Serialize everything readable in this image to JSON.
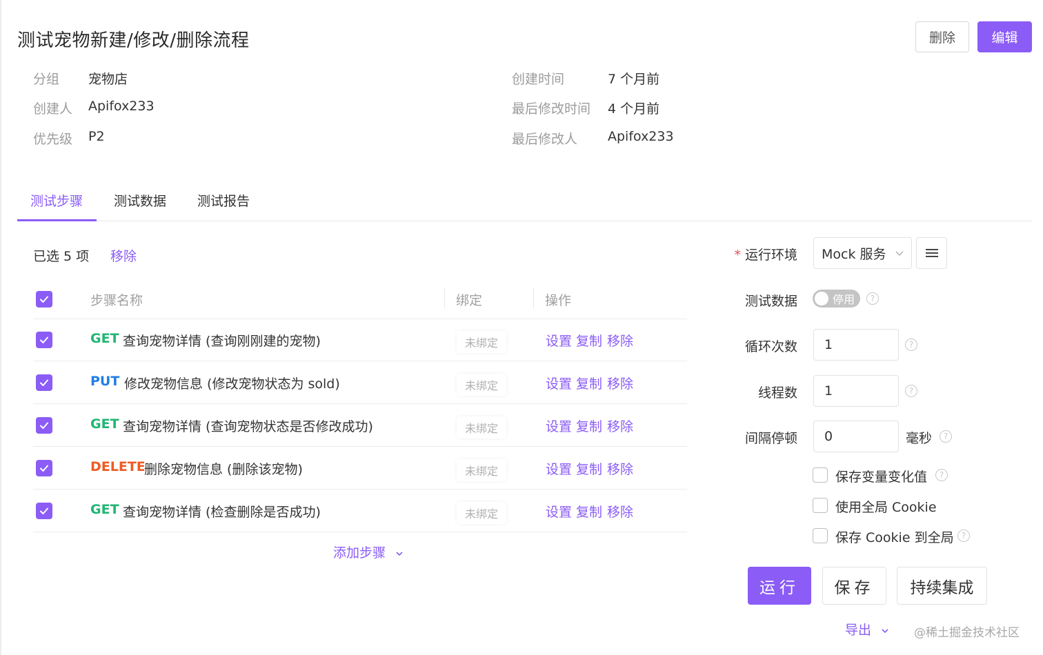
{
  "header": {
    "title": "测试宠物新建/修改/删除流程",
    "delete_label": "删除",
    "edit_label": "编辑"
  },
  "meta": {
    "left": [
      {
        "key": "分组",
        "value": "宠物店"
      },
      {
        "key": "创建人",
        "value": "Apifox233"
      },
      {
        "key": "优先级",
        "value": "P2"
      }
    ],
    "right": [
      {
        "key": "创建时间",
        "value": "7 个月前"
      },
      {
        "key": "最后修改时间",
        "value": "4 个月前"
      },
      {
        "key": "最后修改人",
        "value": "Apifox233"
      }
    ]
  },
  "tabs": [
    {
      "label": "测试步骤",
      "active": true
    },
    {
      "label": "测试数据",
      "active": false
    },
    {
      "label": "测试报告",
      "active": false
    }
  ],
  "selection": {
    "text": "已选 5 项",
    "remove_label": "移除"
  },
  "table": {
    "headers": {
      "name": "步骤名称",
      "bind": "绑定",
      "ops": "操作"
    },
    "rows": [
      {
        "method": "GET",
        "name": "查询宠物详情 (查询刚刚建的宠物)",
        "bind": "未绑定",
        "checked": true
      },
      {
        "method": "PUT",
        "name": "修改宠物信息 (修改宠物状态为 sold)",
        "bind": "未绑定",
        "checked": true
      },
      {
        "method": "GET",
        "name": "查询宠物详情 (查询宠物状态是否修改成功)",
        "bind": "未绑定",
        "checked": true
      },
      {
        "method": "DELETE",
        "name": "删除宠物信息 (删除该宠物)",
        "bind": "未绑定",
        "checked": true
      },
      {
        "method": "GET",
        "name": "查询宠物详情 (检查删除是否成功)",
        "bind": "未绑定",
        "checked": true
      }
    ],
    "ops": [
      "设置",
      "复制",
      "移除"
    ],
    "add_step_label": "添加步骤"
  },
  "settings": {
    "env_label": "运行环境",
    "env_required_mark": "*",
    "env_value": "Mock 服务",
    "test_data_label": "测试数据",
    "test_data_toggle": "停用",
    "loop_label": "循环次数",
    "loop_value": "1",
    "threads_label": "线程数",
    "threads_value": "1",
    "interval_label": "间隔停顿",
    "interval_value": "0",
    "interval_unit": "毫秒",
    "options": [
      {
        "label": "保存变量变化值",
        "checked": false,
        "help": true
      },
      {
        "label": "使用全局 Cookie",
        "checked": false,
        "help": false
      },
      {
        "label": "保存 Cookie 到全局",
        "checked": false,
        "help": true
      }
    ]
  },
  "actions": {
    "run_label": "运行",
    "save_label": "保存",
    "ci_label": "持续集成",
    "export_label": "导出"
  },
  "watermark": "@稀土掘金技术社区",
  "colors": {
    "accent": "#8b5cf6",
    "get": "#21b573",
    "put": "#1f7ee8",
    "delete": "#ee5a24"
  }
}
